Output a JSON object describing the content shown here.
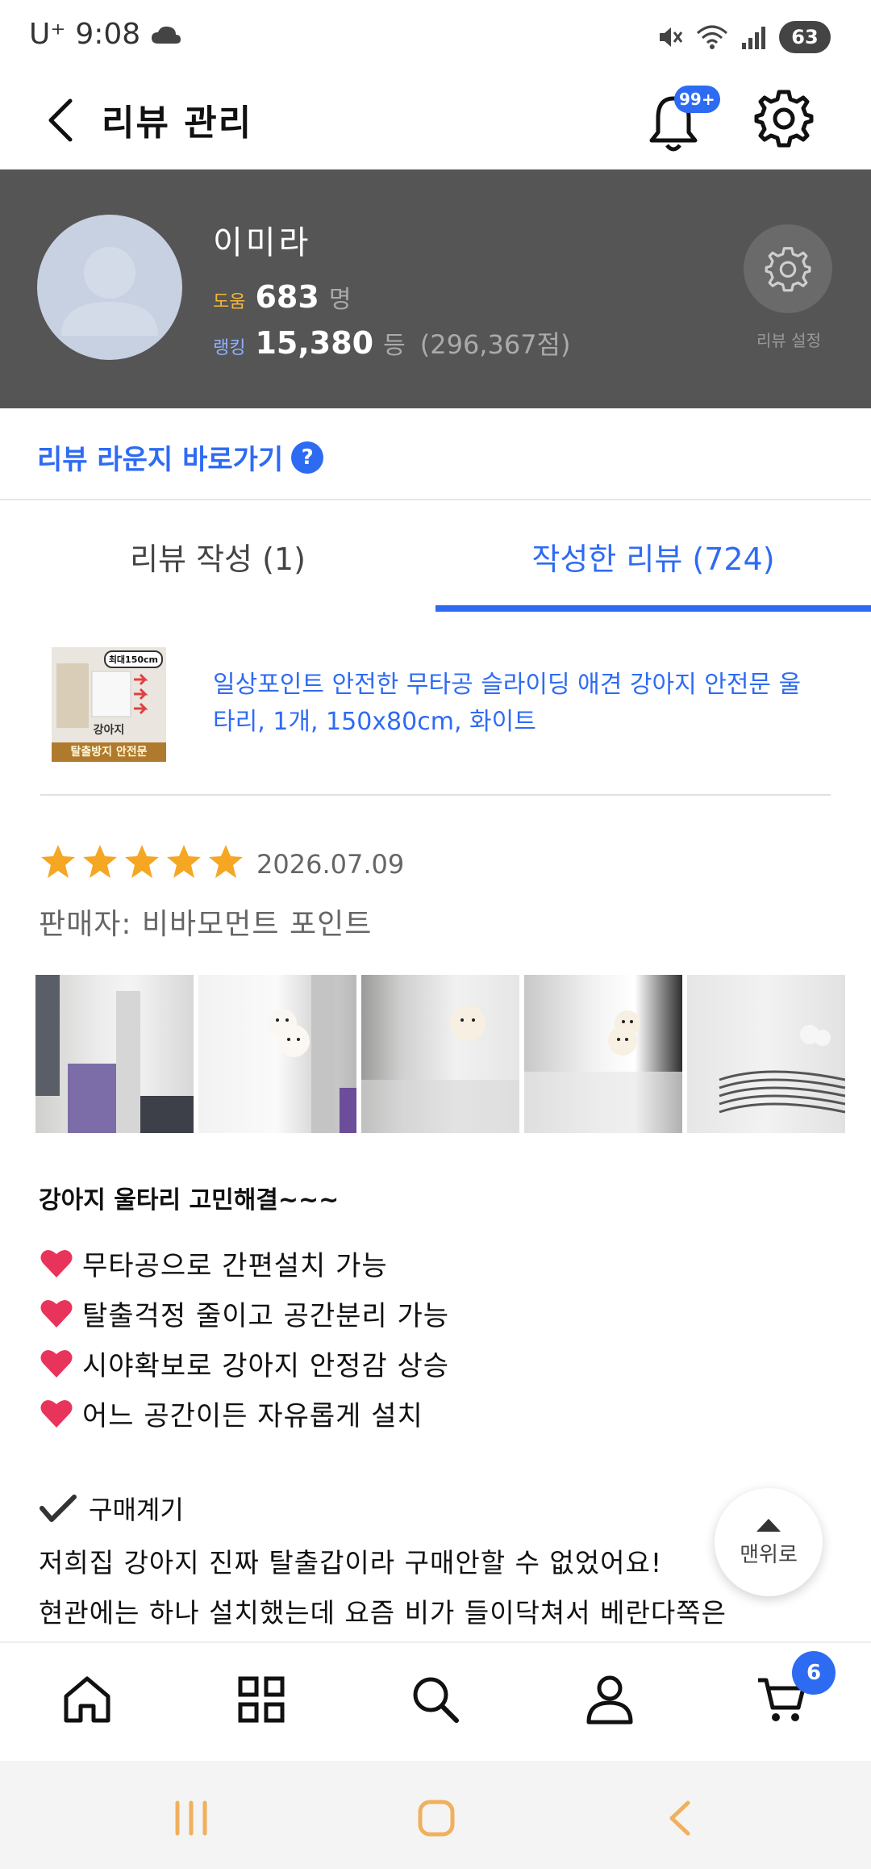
{
  "status_bar": {
    "carrier": "U⁺",
    "time": "9:08",
    "battery": "63"
  },
  "header": {
    "title": "리뷰 관리",
    "notification_badge": "99+"
  },
  "profile": {
    "name": "이미라",
    "help_label": "도움",
    "help_count": "683",
    "help_unit": "명",
    "rank_label": "랭킹",
    "rank_value": "15,380",
    "rank_unit": "등",
    "points": "(296,367점)",
    "setting_label": "리뷰 설정"
  },
  "lounge": {
    "link_label": "리뷰 라운지 바로가기",
    "help_mark": "?"
  },
  "tabs": [
    {
      "label": "리뷰 작성 (1)",
      "active": false
    },
    {
      "label": "작성한 리뷰 (724)",
      "active": true
    }
  ],
  "product": {
    "thumb_tag": "최대150cm",
    "thumb_label1": "강아지",
    "thumb_label2": "탈출방지 안전문",
    "name": "일상포인트 안전한 무타공 슬라이딩 애견 강아지 안전문 울타리, 1개, 150x80cm, 화이트"
  },
  "review": {
    "rating": 5,
    "date": "2026.07.09",
    "seller": "판매자: 비바모먼트 포인트",
    "photo_count": 5,
    "headline": "강아지 울타리 고민해결~~~",
    "bullets": [
      "무타공으로 간편설치 가능",
      "탈출걱정 줄이고 공간분리 가능",
      "시야확보로 강아지 안정감 상승",
      "어느 공간이든 자유롭게 설치"
    ],
    "purpose_title": "구매계기",
    "body_lines": [
      "저희집 강아지 진짜 탈출갑이라 구매안할 수 없었어요!",
      "현관에는 하나 설치했는데 요즘 비가 들이닥쳐서 베란다쪽은"
    ]
  },
  "to_top_label": "맨위로",
  "bottom_nav": {
    "cart_count": "6"
  },
  "colors": {
    "accent": "#2e6bf3",
    "profile_bg": "#555555",
    "star": "#f5a623",
    "heart": "#e8345a"
  },
  "icons": [
    "back-arrow-icon",
    "bell-icon",
    "gear-icon",
    "home-icon",
    "grid-icon",
    "search-icon",
    "user-icon",
    "cart-icon"
  ]
}
